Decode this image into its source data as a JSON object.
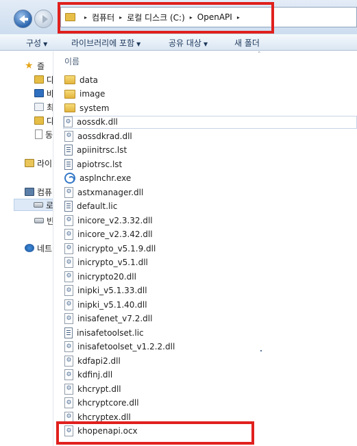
{
  "address_bar": {
    "folder_icon": "folder-icon",
    "breadcrumbs": [
      "컴퓨터",
      "로컬 디스크 (C:)",
      "OpenAPI"
    ],
    "separator": "▸"
  },
  "nav_buttons": {
    "back": "back-arrow-icon",
    "forward": "forward-arrow-icon"
  },
  "toolbar": {
    "organize": "구성",
    "include_library": "라이브러리에 포함",
    "share_with": "공유 대상",
    "new_folder": "새 폴더"
  },
  "nav_pane": {
    "items": [
      {
        "label": "즐",
        "icon": "favorites-star-icon"
      },
      {
        "label": "다",
        "icon": "downloads-icon"
      },
      {
        "label": "바",
        "icon": "desktop-icon"
      },
      {
        "label": "최",
        "icon": "recent-places-icon"
      },
      {
        "label": "다",
        "icon": "downloads-folder-icon"
      },
      {
        "label": "동",
        "icon": "document-icon"
      },
      {
        "label": "라이",
        "icon": "libraries-icon"
      },
      {
        "label": "컴퓨",
        "icon": "computer-icon"
      },
      {
        "label": "로",
        "icon": "local-drive-icon"
      },
      {
        "label": "빈",
        "icon": "drive-icon"
      },
      {
        "label": "네트",
        "icon": "network-icon"
      }
    ]
  },
  "content": {
    "column_header": "이름",
    "files": [
      {
        "name": "data",
        "type": "folder"
      },
      {
        "name": "image",
        "type": "folder"
      },
      {
        "name": "system",
        "type": "folder"
      },
      {
        "name": "aossdk.dll",
        "type": "dll"
      },
      {
        "name": "aossdkrad.dll",
        "type": "dll"
      },
      {
        "name": "apiinitrsc.lst",
        "type": "lst"
      },
      {
        "name": "apiotrsc.lst",
        "type": "lst"
      },
      {
        "name": "asplnchr.exe",
        "type": "exe"
      },
      {
        "name": "astxmanager.dll",
        "type": "dll"
      },
      {
        "name": "default.lic",
        "type": "lst"
      },
      {
        "name": "inicore_v2.3.32.dll",
        "type": "dll"
      },
      {
        "name": "inicore_v2.3.42.dll",
        "type": "dll"
      },
      {
        "name": "inicrypto_v5.1.9.dll",
        "type": "dll"
      },
      {
        "name": "inicrypto_v5.1.dll",
        "type": "dll"
      },
      {
        "name": "inicrypto20.dll",
        "type": "dll"
      },
      {
        "name": "inipki_v5.1.33.dll",
        "type": "dll"
      },
      {
        "name": "inipki_v5.1.40.dll",
        "type": "dll"
      },
      {
        "name": "inisafenet_v7.2.dll",
        "type": "dll"
      },
      {
        "name": "inisafetoolset.lic",
        "type": "lst"
      },
      {
        "name": "inisafetoolset_v1.2.2.dll",
        "type": "dll"
      },
      {
        "name": "kdfapi2.dll",
        "type": "dll"
      },
      {
        "name": "kdfinj.dll",
        "type": "dll"
      },
      {
        "name": "khcrypt.dll",
        "type": "dll"
      },
      {
        "name": "khcryptcore.dll",
        "type": "dll"
      },
      {
        "name": "khcryptex.dll",
        "type": "dll"
      },
      {
        "name": "khopenapi.ocx",
        "type": "dll"
      }
    ]
  },
  "highlight_color": "#e0201d"
}
